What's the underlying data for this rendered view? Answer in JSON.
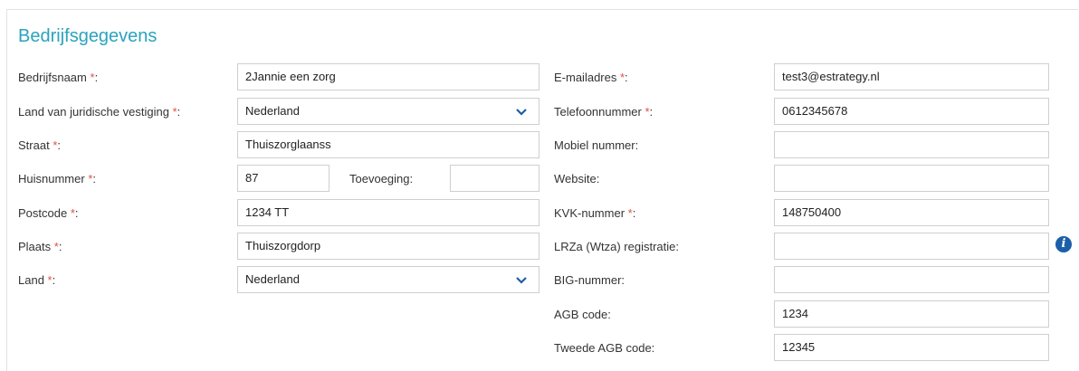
{
  "section": {
    "title": "Bedrijfsgegevens"
  },
  "required_marker": "*",
  "left": {
    "bedrijfsnaam": {
      "label": "Bedrijfsnaam",
      "suffix": ":",
      "value": "2Jannie een zorg"
    },
    "land_vestiging": {
      "label": "Land van juridische vestiging",
      "suffix": ":",
      "value": "Nederland"
    },
    "straat": {
      "label": "Straat",
      "suffix": ":",
      "value": "Thuiszorglaanss"
    },
    "huisnummer": {
      "label": "Huisnummer",
      "suffix": ":",
      "value": "87"
    },
    "toevoeging": {
      "label": "Toevoeging:",
      "value": ""
    },
    "postcode": {
      "label": "Postcode",
      "suffix": ":",
      "value": "1234 TT"
    },
    "plaats": {
      "label": "Plaats",
      "suffix": ":",
      "value": "Thuiszorgdorp"
    },
    "land": {
      "label": "Land",
      "suffix": ":",
      "value": "Nederland"
    }
  },
  "right": {
    "email": {
      "label": "E-mailadres",
      "suffix": ":",
      "value": "test3@estrategy.nl"
    },
    "telefoon": {
      "label": "Telefoonnummer",
      "suffix": ":",
      "value": "0612345678"
    },
    "mobiel": {
      "label": "Mobiel nummer:",
      "value": ""
    },
    "website": {
      "label": "Website:",
      "value": ""
    },
    "kvk": {
      "label": "KVK-nummer",
      "suffix": ":",
      "value": "148750400"
    },
    "lrza": {
      "label": "LRZa (Wtza) registratie:",
      "value": ""
    },
    "big": {
      "label": "BIG-nummer:",
      "value": ""
    },
    "agb": {
      "label": "AGB code:",
      "value": "1234"
    },
    "agb2": {
      "label": "Tweede AGB code:",
      "value": "12345"
    }
  },
  "icons": {
    "info": "info-icon",
    "chevron": "chevron-down-icon"
  },
  "colors": {
    "title": "#2aa3bd",
    "required": "#e0523f",
    "info": "#1b5fa8",
    "chevron": "#1b5fa8"
  }
}
